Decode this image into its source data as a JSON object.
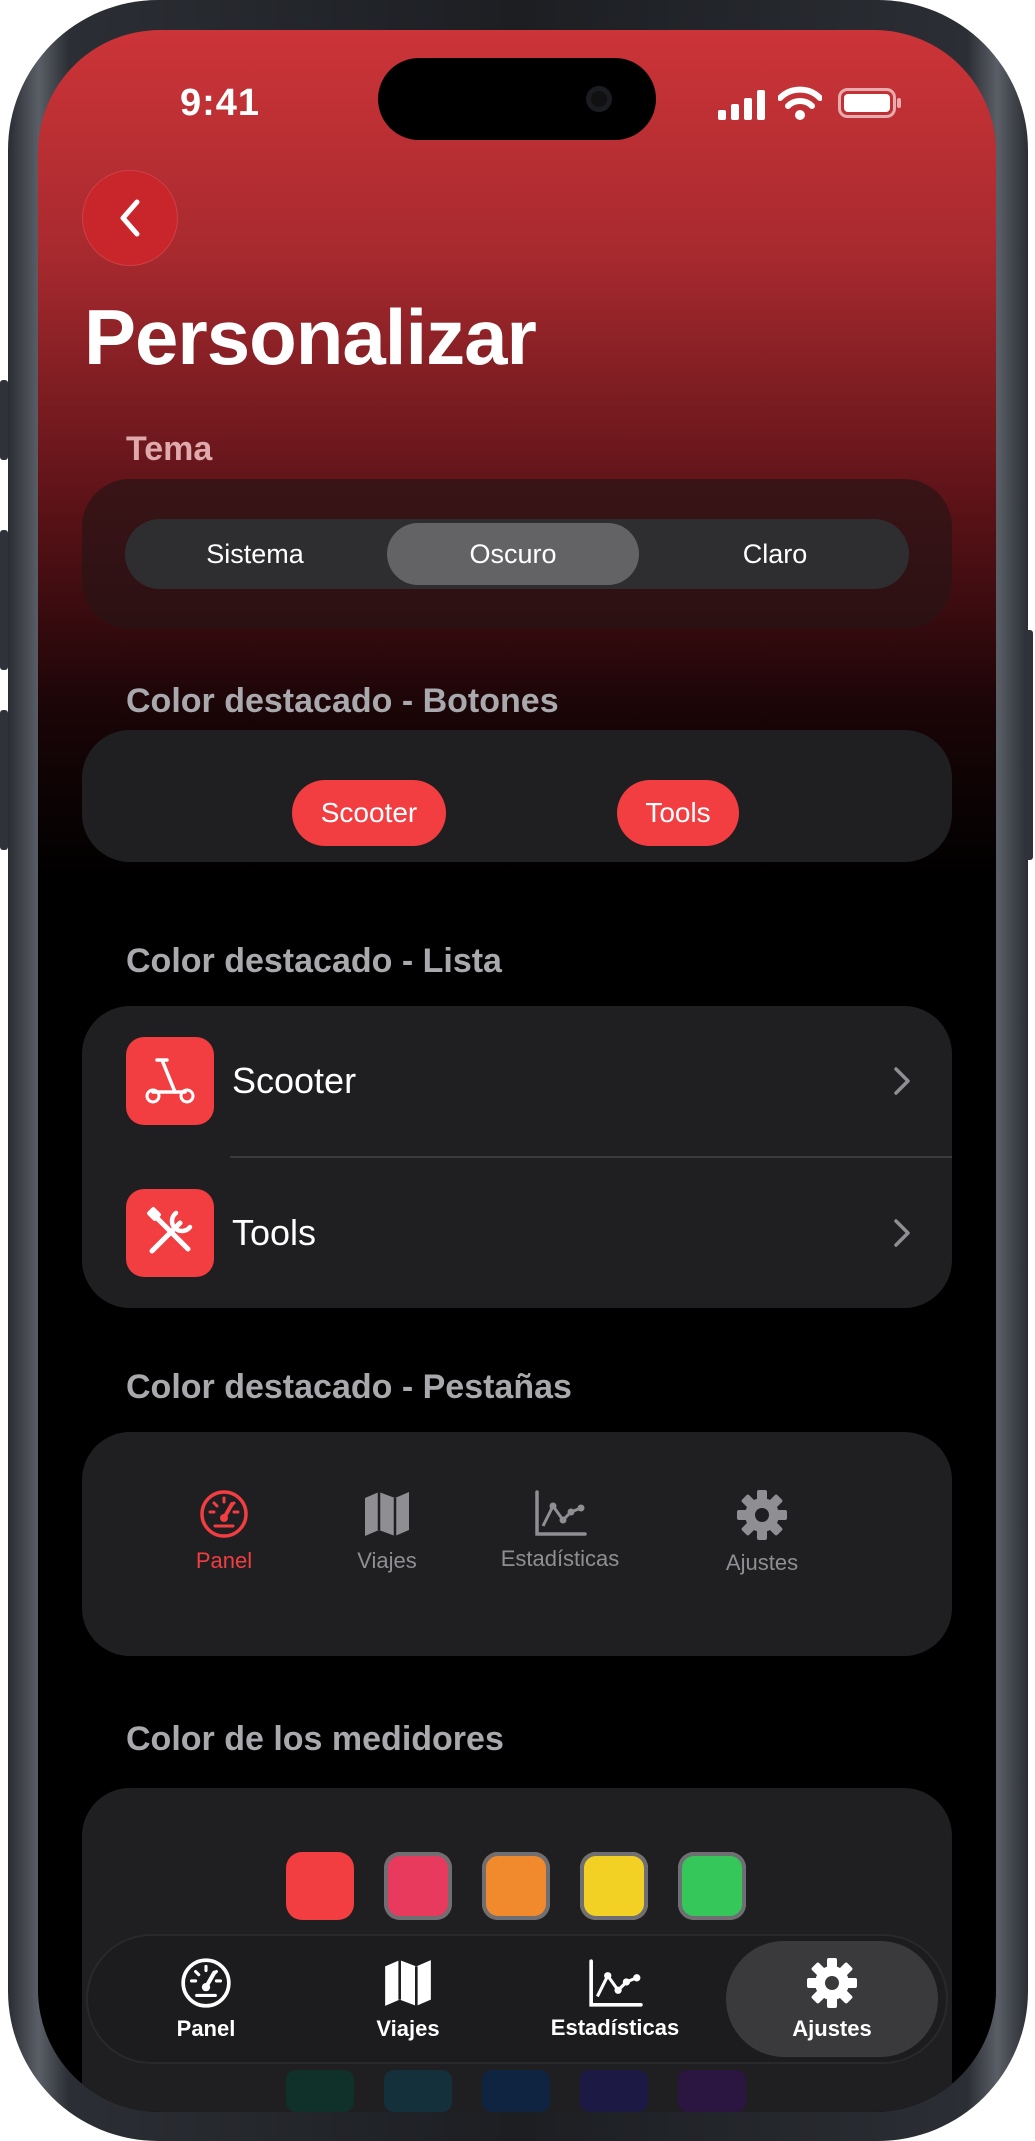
{
  "status_bar": {
    "time": "9:41"
  },
  "header": {
    "title": "Personalizar"
  },
  "theme_section": {
    "label": "Tema",
    "options": [
      "Sistema",
      "Oscuro",
      "Claro"
    ],
    "selected": "Oscuro"
  },
  "buttons_section": {
    "label": "Color destacado - Botones",
    "buttons": [
      "Scooter",
      "Tools"
    ]
  },
  "list_section": {
    "label": "Color destacado - Lista",
    "items": [
      {
        "label": "Scooter",
        "icon": "scooter-icon"
      },
      {
        "label": "Tools",
        "icon": "tools-icon"
      }
    ]
  },
  "tabs_section": {
    "label": "Color destacado - Pestañas",
    "tabs": [
      {
        "label": "Panel",
        "icon": "speedometer-icon",
        "active": true
      },
      {
        "label": "Viajes",
        "icon": "map-icon"
      },
      {
        "label": "Estadísticas",
        "icon": "chart-icon"
      },
      {
        "label": "Ajustes",
        "icon": "gear-icon"
      }
    ]
  },
  "gauges_section": {
    "label": "Color de los medidores",
    "swatches": [
      "#f23d41",
      "#e83a5c",
      "#f08a2c",
      "#f2d024",
      "#35c759"
    ]
  },
  "colors": {
    "accent": "#f23d41"
  },
  "tab_bar": {
    "tabs": [
      {
        "label": "Panel",
        "icon": "speedometer-icon"
      },
      {
        "label": "Viajes",
        "icon": "map-icon"
      },
      {
        "label": "Estadísticas",
        "icon": "chart-icon"
      },
      {
        "label": "Ajustes",
        "icon": "gear-icon",
        "active": true
      }
    ]
  }
}
